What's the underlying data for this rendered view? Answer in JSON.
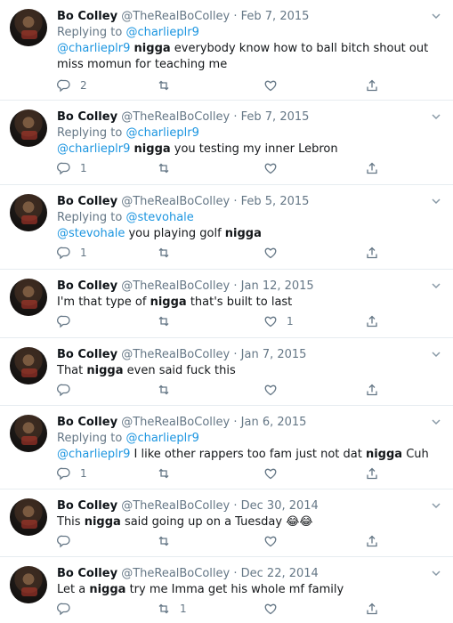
{
  "tweets": [
    {
      "name": "Bo Colley",
      "handle": "@TheRealBoColley",
      "sep": "·",
      "date": "Feb 7, 2015",
      "replying_prefix": "Replying to ",
      "replying_to": "@charlieplr9",
      "mention": "@charlieplr9",
      "bold": "nigga",
      "text_rest": " everybody know how to ball bitch shout out miss momun for teaching me",
      "reply_count": "2",
      "retweet_count": "",
      "like_count": ""
    },
    {
      "name": "Bo Colley",
      "handle": "@TheRealBoColley",
      "sep": "·",
      "date": "Feb 7, 2015",
      "replying_prefix": "Replying to ",
      "replying_to": "@charlieplr9",
      "mention": "@charlieplr9",
      "bold": "nigga",
      "text_rest": " you testing my inner Lebron",
      "reply_count": "1",
      "retweet_count": "",
      "like_count": ""
    },
    {
      "name": "Bo Colley",
      "handle": "@TheRealBoColley",
      "sep": "·",
      "date": "Feb 5, 2015",
      "replying_prefix": "Replying to ",
      "replying_to": "@stevohale",
      "mention": "@stevohale",
      "text_mid": " you playing golf ",
      "bold": "nigga",
      "reply_count": "1",
      "retweet_count": "",
      "like_count": ""
    },
    {
      "name": "Bo Colley",
      "handle": "@TheRealBoColley",
      "sep": "·",
      "date": "Jan 12, 2015",
      "text_pre": "I'm that type of ",
      "bold": "nigga",
      "text_rest": " that's built to last",
      "reply_count": "",
      "retweet_count": "",
      "like_count": "1"
    },
    {
      "name": "Bo Colley",
      "handle": "@TheRealBoColley",
      "sep": "·",
      "date": "Jan 7, 2015",
      "text_pre": "That ",
      "bold": "nigga",
      "text_rest": " even said fuck this",
      "reply_count": "",
      "retweet_count": "",
      "like_count": ""
    },
    {
      "name": "Bo Colley",
      "handle": "@TheRealBoColley",
      "sep": "·",
      "date": "Jan 6, 2015",
      "replying_prefix": "Replying to ",
      "replying_to": "@charlieplr9",
      "mention": "@charlieplr9",
      "text_mid": " I like other rappers too fam just not dat ",
      "bold": "nigga",
      "text_rest": " Cuh",
      "reply_count": "1",
      "retweet_count": "",
      "like_count": ""
    },
    {
      "name": "Bo Colley",
      "handle": "@TheRealBoColley",
      "sep": "·",
      "date": "Dec 30, 2014",
      "text_pre": "This ",
      "bold": "nigga",
      "text_rest": " said going up on a Tuesday 😂😂",
      "reply_count": "",
      "retweet_count": "",
      "like_count": ""
    },
    {
      "name": "Bo Colley",
      "handle": "@TheRealBoColley",
      "sep": "·",
      "date": "Dec 22, 2014",
      "text_pre": "Let a ",
      "bold": "nigga",
      "text_rest": " try me Imma get his whole mf family",
      "reply_count": "",
      "retweet_count": "1",
      "like_count": ""
    }
  ],
  "icons": {
    "reply": "reply-icon",
    "retweet": "retweet-icon",
    "like": "heart-icon",
    "share": "share-icon",
    "caret": "chevron-down-icon"
  },
  "colors": {
    "link": "#1b95e0",
    "muted": "#657786",
    "border": "#e6ecf0"
  }
}
